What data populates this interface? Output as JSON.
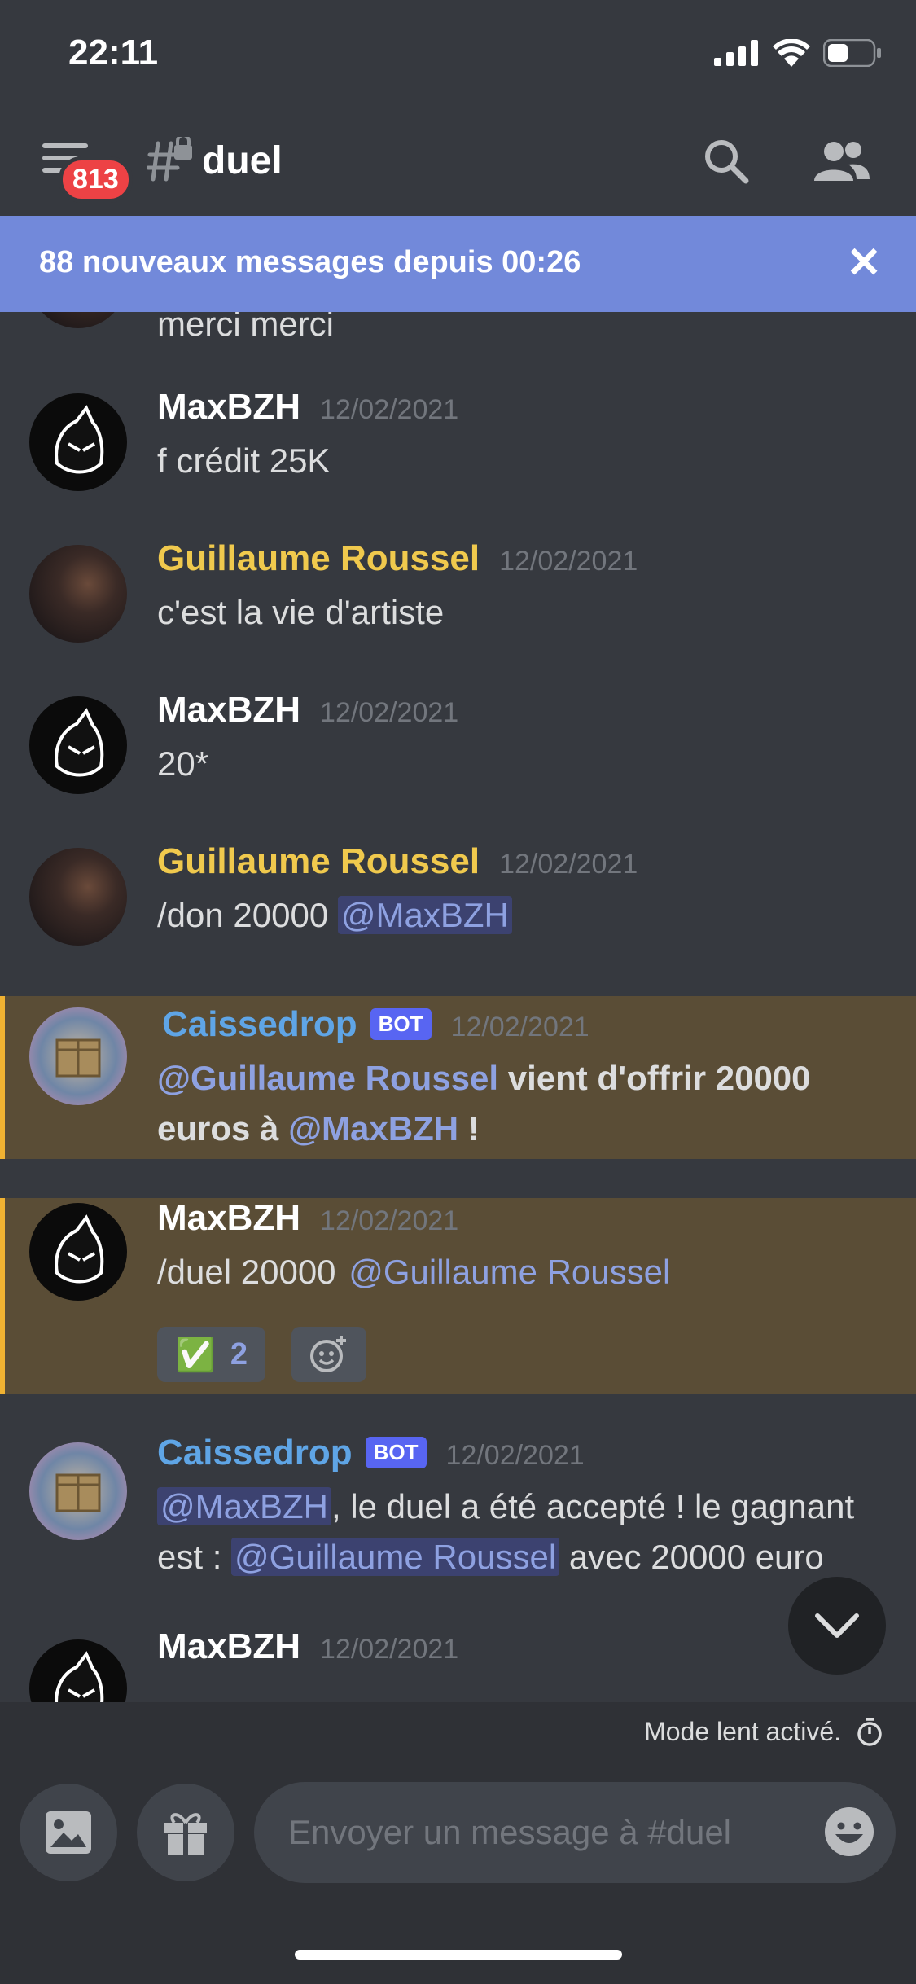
{
  "status": {
    "time": "22:11"
  },
  "header": {
    "badge": "813",
    "channel": "duel"
  },
  "banner": {
    "text": "88 nouveaux messages depuis 00:26",
    "close": "✕"
  },
  "messages": [
    {
      "text": "merci merci"
    },
    {
      "author": "MaxBZH",
      "time": "12/02/2021",
      "text": "f crédit 25K"
    },
    {
      "author": "Guillaume Roussel",
      "time": "12/02/2021",
      "text": "c'est la vie d'artiste"
    },
    {
      "author": "MaxBZH",
      "time": "12/02/2021",
      "text": "20*"
    },
    {
      "author": "Guillaume Roussel",
      "time": "12/02/2021",
      "text": "/don 20000 ",
      "mention": "@MaxBZH"
    },
    {
      "author": "Caissedrop",
      "tag": "BOT",
      "time": "12/02/2021",
      "mention1": "@Guillaume Roussel",
      "mid": " vient d'offrir 20000 euros à ",
      "mention2": "@MaxBZH",
      "end": " !"
    },
    {
      "author": "MaxBZH",
      "time": "12/02/2021",
      "text": "/duel 20000 ",
      "mention": "@Guillaume Roussel",
      "reaction_emoji": "✅",
      "reaction_count": "2"
    },
    {
      "author": "Caissedrop",
      "tag": "BOT",
      "time": "12/02/2021",
      "mention1": "@MaxBZH",
      "mid": ", le duel a été accepté ! le gagnant est : ",
      "mention2": "@Guillaume Roussel",
      "end": " avec 20000 euro"
    },
    {
      "author": "MaxBZH",
      "time": "12/02/2021"
    }
  ],
  "slowmode": {
    "text": "Mode lent activé."
  },
  "composer": {
    "placeholder": "Envoyer un message à #duel"
  },
  "colors": {
    "max": "#ffffff",
    "guillaume": "#f0c94d",
    "bot": "#5fa5e6",
    "highlight": "#5a4d36",
    "accent": "#7289da"
  }
}
